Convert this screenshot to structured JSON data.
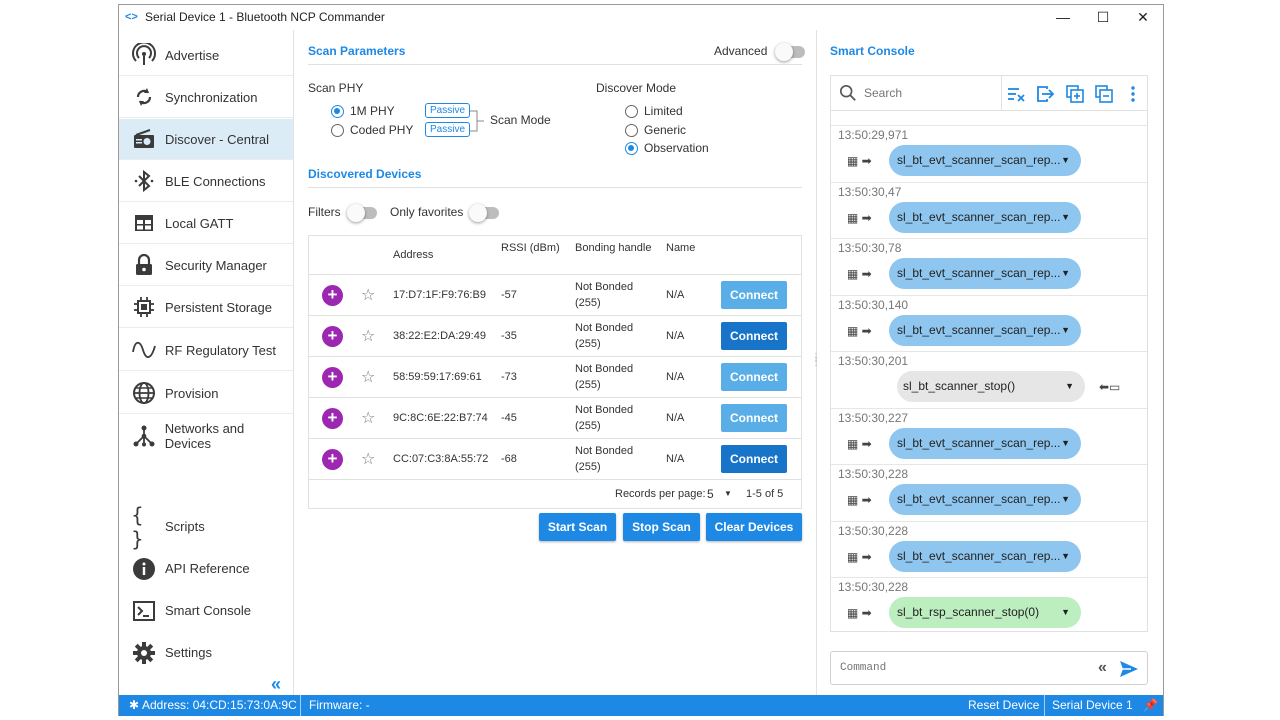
{
  "window": {
    "title": "Serial Device 1 - Bluetooth NCP Commander",
    "min": "—",
    "max": "☐",
    "close": "✕"
  },
  "sidebar": {
    "items": [
      {
        "label": "Advertise",
        "icon": "advertise-icon"
      },
      {
        "label": "Synchronization",
        "icon": "sync-icon"
      },
      {
        "label": "Discover - Central",
        "icon": "radio-icon",
        "active": true
      },
      {
        "label": "BLE Connections",
        "icon": "bluetooth-icon"
      },
      {
        "label": "Local GATT",
        "icon": "table-icon"
      },
      {
        "label": "Security Manager",
        "icon": "lock-icon"
      },
      {
        "label": "Persistent Storage",
        "icon": "chip-icon"
      },
      {
        "label": "RF Regulatory Test",
        "icon": "wave-icon"
      },
      {
        "label": "Provision",
        "icon": "globe-icon"
      },
      {
        "label": "Networks and Devices",
        "icon": "network-icon"
      }
    ],
    "bottom_items": [
      {
        "label": "Scripts",
        "icon": "braces-icon"
      },
      {
        "label": "API Reference",
        "icon": "info-icon"
      },
      {
        "label": "Smart Console",
        "icon": "terminal-icon"
      },
      {
        "label": "Settings",
        "icon": "gear-icon"
      }
    ],
    "collapse": "«"
  },
  "scan": {
    "title": "Scan Parameters",
    "advanced_label": "Advanced",
    "phy_label": "Scan PHY",
    "phy_1m": "1M PHY",
    "phy_coded": "Coded PHY",
    "passive_1": "Passive",
    "passive_2": "Passive",
    "scan_mode": "Scan Mode",
    "discover_mode_label": "Discover Mode",
    "mode_limited": "Limited",
    "mode_generic": "Generic",
    "mode_observation": "Observation"
  },
  "discovered": {
    "title": "Discovered Devices",
    "filters_label": "Filters",
    "favorites_label": "Only favorites",
    "columns": {
      "address": "Address",
      "rssi": "RSSI (dBm)",
      "bonding": "Bonding handle",
      "name": "Name"
    },
    "rows": [
      {
        "address": "17:D7:1F:F9:76:B9",
        "rssi": "-57",
        "bond1": "Not Bonded",
        "bond2": "(255)",
        "name": "N/A",
        "connect": "Connect",
        "style": "light"
      },
      {
        "address": "38:22:E2:DA:29:49",
        "rssi": "-35",
        "bond1": "Not Bonded",
        "bond2": "(255)",
        "name": "N/A",
        "connect": "Connect",
        "style": "dark"
      },
      {
        "address": "58:59:59:17:69:61",
        "rssi": "-73",
        "bond1": "Not Bonded",
        "bond2": "(255)",
        "name": "N/A",
        "connect": "Connect",
        "style": "light"
      },
      {
        "address": "9C:8C:6E:22:B7:74",
        "rssi": "-45",
        "bond1": "Not Bonded",
        "bond2": "(255)",
        "name": "N/A",
        "connect": "Connect",
        "style": "light"
      },
      {
        "address": "CC:07:C3:8A:55:72",
        "rssi": "-68",
        "bond1": "Not Bonded",
        "bond2": "(255)",
        "name": "N/A",
        "connect": "Connect",
        "style": "dark"
      }
    ],
    "records_label": "Records per page:",
    "records_value": "5",
    "range": "1-5 of 5"
  },
  "actions": {
    "start": "Start Scan",
    "stop": "Stop Scan",
    "clear": "Clear Devices"
  },
  "console": {
    "title": "Smart Console",
    "search_placeholder": "Search",
    "entries": [
      {
        "ts": "13:50:29,971",
        "text": "sl_bt_evt_scanner_scan_rep...",
        "kind": "evt"
      },
      {
        "ts": "13:50:30,47",
        "text": "sl_bt_evt_scanner_scan_rep...",
        "kind": "evt"
      },
      {
        "ts": "13:50:30,78",
        "text": "sl_bt_evt_scanner_scan_rep...",
        "kind": "evt"
      },
      {
        "ts": "13:50:30,140",
        "text": "sl_bt_evt_scanner_scan_rep...",
        "kind": "evt"
      },
      {
        "ts": "13:50:30,201",
        "text": "sl_bt_scanner_stop()",
        "kind": "cmd"
      },
      {
        "ts": "13:50:30,227",
        "text": "sl_bt_evt_scanner_scan_rep...",
        "kind": "evt"
      },
      {
        "ts": "13:50:30,228",
        "text": "sl_bt_evt_scanner_scan_rep...",
        "kind": "evt"
      },
      {
        "ts": "13:50:30,228",
        "text": "sl_bt_evt_scanner_scan_rep...",
        "kind": "evt"
      },
      {
        "ts": "13:50:30,228",
        "text": "sl_bt_rsp_scanner_stop(0)",
        "kind": "rsp"
      }
    ],
    "command_placeholder": "Command"
  },
  "status": {
    "address": "Address: 04:CD:15:73:0A:9C",
    "firmware": "Firmware: -",
    "reset": "Reset Device",
    "device": "Serial Device 1"
  },
  "colors": {
    "accent": "#1e88e5",
    "bubble_evt": "#8ec6ef",
    "bubble_rsp": "#bdeec0",
    "bubble_cmd": "#e6e6e6",
    "plus": "#9c27b0"
  }
}
